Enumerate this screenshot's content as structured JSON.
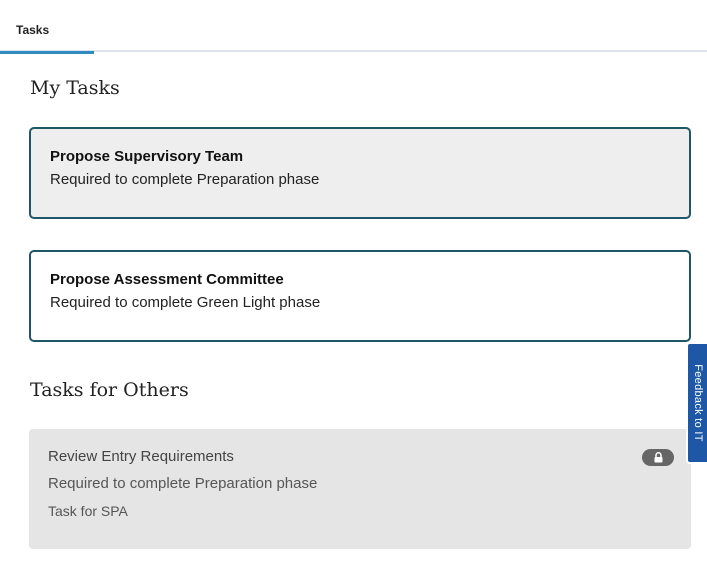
{
  "tabs": [
    {
      "label": "Tasks",
      "active": true
    }
  ],
  "my_tasks": {
    "heading": "My Tasks",
    "items": [
      {
        "title": "Propose Supervisory Team",
        "subtitle": "Required to complete Preparation phase"
      },
      {
        "title": "Propose Assessment Committee",
        "subtitle": "Required to complete Green Light phase"
      }
    ]
  },
  "tasks_for_others": {
    "heading": "Tasks for Others",
    "items": [
      {
        "title": "Review Entry Requirements",
        "subtitle": "Required to complete Preparation phase",
        "assignee": "Task for SPA",
        "icon": "lock-icon"
      }
    ]
  },
  "feedback": {
    "label": "Feedback to IT"
  },
  "colors": {
    "accent": "#2f8bc2",
    "card_border": "#1f5668",
    "feedback_bg": "#1e57a6",
    "others_bg": "#e5e5e5"
  }
}
